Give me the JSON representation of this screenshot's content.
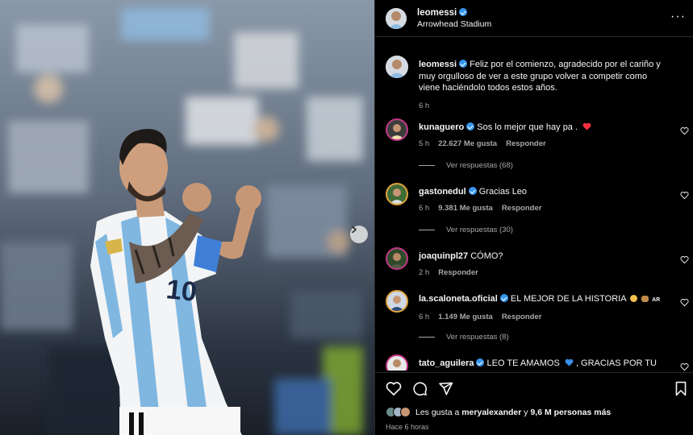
{
  "post": {
    "username": "leomessi",
    "location": "Arrowhead Stadium",
    "caption": "Feliz por el comienzo, agradecido por el cariño y muy orgulloso de ver a este grupo volver a competir como viene haciéndolo todos estos años.",
    "caption_time": "6 h",
    "more_icon": "more-horizontal-icon"
  },
  "comments": [
    {
      "username": "kunaguero",
      "verified": true,
      "text": "Sos lo mejor que hay pa .",
      "emoji": "heart",
      "time": "5 h",
      "likes": "22.627 Me gusta",
      "reply": "Responder",
      "view_replies": "Ver respuestas (68)"
    },
    {
      "username": "gastonedul",
      "verified": true,
      "text": "Gracias Leo",
      "time": "6 h",
      "likes": "9.381 Me gusta",
      "reply": "Responder",
      "view_replies": "Ver respuestas (30)"
    },
    {
      "username": "joaquinpl27",
      "verified": false,
      "text": "CÓMO?",
      "time": "2 h",
      "reply": "Responder"
    },
    {
      "username": "la.scaloneta.oficial",
      "verified": true,
      "text": "EL MEJOR DE LA HISTORIA",
      "emoji": "clap-goat-ar",
      "time": "6 h",
      "likes": "1.149 Me gusta",
      "reply": "Responder",
      "view_replies": "Ver respuestas (8)"
    },
    {
      "username": "tato_aguilera",
      "verified": true,
      "text": "LEO TE AMAMOS",
      "text2": ", GRACIAS POR TU",
      "emoji": "blue-heart"
    }
  ],
  "footer": {
    "likes_prefix": "Les gusta a",
    "likes_user": "meryalexander",
    "likes_middle": "y",
    "likes_count": "9,6 M personas más",
    "time_ago": "Hace 6 horas"
  },
  "icons": [
    "like-icon",
    "comment-icon",
    "share-icon",
    "save-icon",
    "next-arrow-icon"
  ],
  "colors": {
    "background": "#000000",
    "verified": "#3797f0",
    "secondary_text": "#a8a8a8",
    "heart": "#ff3040"
  }
}
